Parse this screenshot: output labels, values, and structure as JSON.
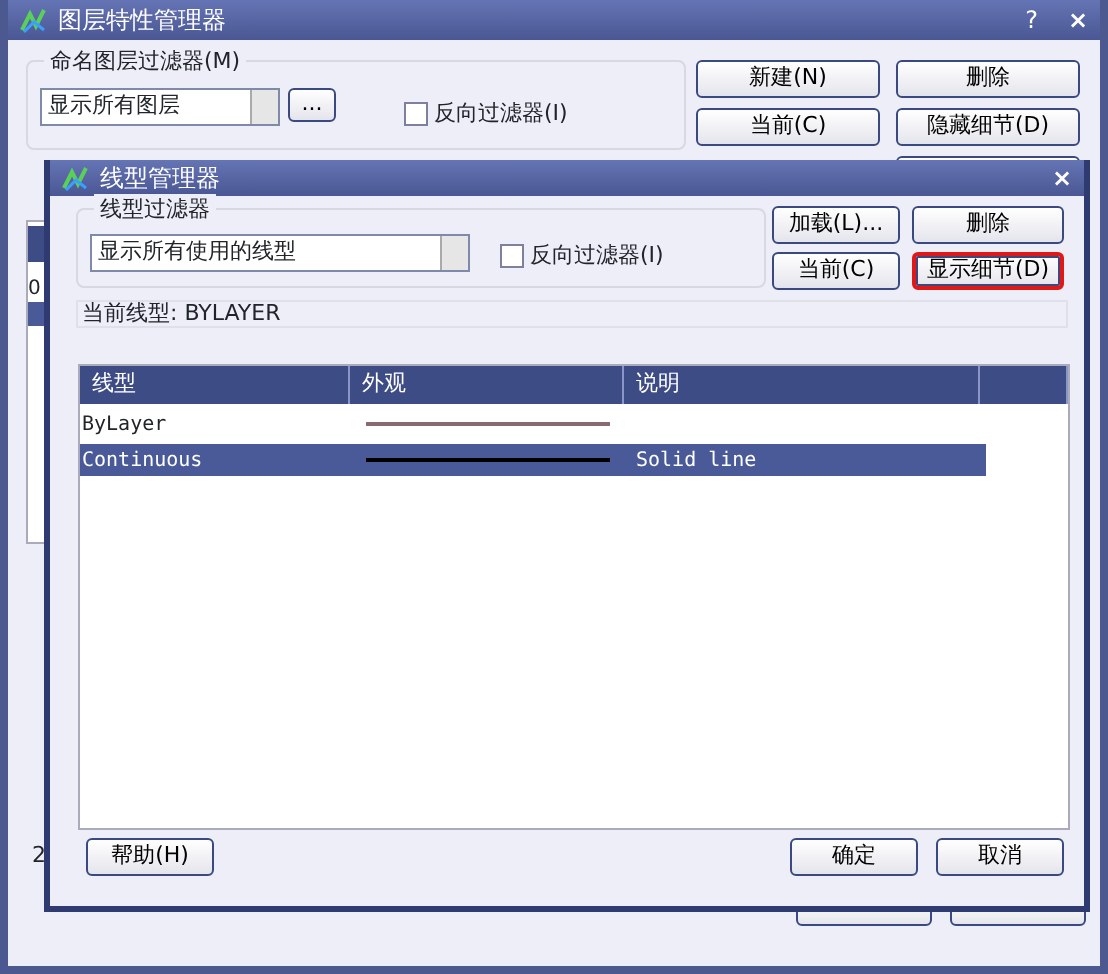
{
  "back_window": {
    "title": "图层特性管理器",
    "help_glyph": "?",
    "close_glyph": "×",
    "filter_group": {
      "label": "命名图层过滤器(M)",
      "combo_value": "显示所有图层",
      "browse_label": "...",
      "invert": {
        "label": "反向过滤器(I)",
        "checked": false
      }
    },
    "buttons": [
      "新建(N)",
      "删除",
      "当前(C)",
      "隐藏细节(D)"
    ],
    "list_fragments": [
      {
        "text": "0",
        "selected": false
      }
    ],
    "status_fragment": "2"
  },
  "dialog": {
    "title": "线型管理器",
    "close_glyph": "×",
    "filter_group": {
      "label": "线型过滤器",
      "combo_value": "显示所有使用的线型",
      "invert": {
        "label": "反向过滤器(I)",
        "checked": false
      }
    },
    "buttons": [
      {
        "label": "加载(L)...",
        "highlighted": false
      },
      {
        "label": "删除",
        "highlighted": false
      },
      {
        "label": "当前(C)",
        "highlighted": false
      },
      {
        "label": "显示细节(D)",
        "highlighted": true
      }
    ],
    "current_linetype": "当前线型: BYLAYER",
    "table": {
      "columns": [
        "线型",
        "外观",
        "说明"
      ],
      "rows": [
        {
          "linetype": "ByLayer",
          "color": "#8a6a70",
          "selected": false
        },
        {
          "linetype": "Continuous",
          "color": "#000000",
          "description": "Solid line",
          "selected": true
        }
      ]
    },
    "footer_buttons": [
      "帮助(H)",
      "确定",
      "取消"
    ]
  }
}
